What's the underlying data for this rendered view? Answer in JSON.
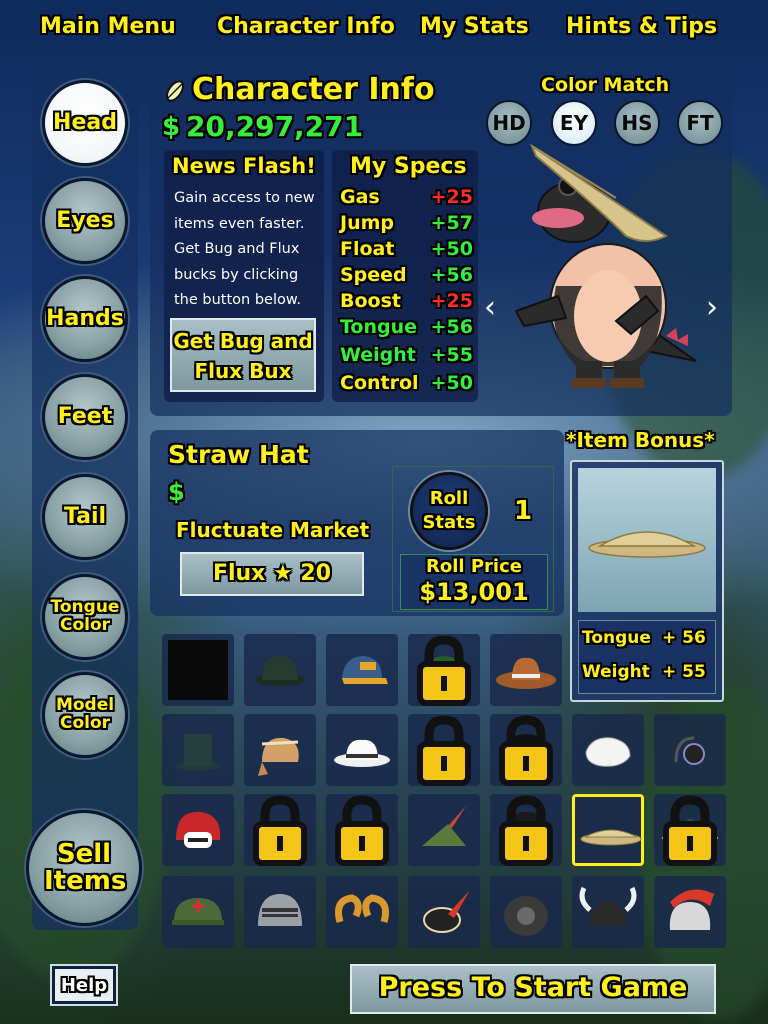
{
  "nav": {
    "main_menu": "Main Menu",
    "character_info": "Character Info",
    "my_stats": "My Stats",
    "hints_tips": "Hints & Tips"
  },
  "side": {
    "head": "Head",
    "eyes": "Eyes",
    "hands": "Hands",
    "feet": "Feet",
    "tail": "Tail",
    "tongue_color": "Tongue Color",
    "model_color": "Model Color",
    "sell_items": "Sell Items",
    "help": "Help"
  },
  "header": {
    "title": "Character Info",
    "money_symbol": "$",
    "money": "20,297,271"
  },
  "color_match": {
    "label": "Color Match",
    "buttons": [
      "HD",
      "EY",
      "HS",
      "FT"
    ],
    "selected": "EY"
  },
  "news": {
    "title": "News Flash!",
    "body": "Gain access to new items even faster. Get Bug and Flux bucks by clicking the button below.",
    "button": "Get Bug and Flux Bux"
  },
  "specs": {
    "title": "My Specs",
    "rows": [
      {
        "name": "Gas",
        "value": "+25",
        "color": "red"
      },
      {
        "name": "Jump",
        "value": "+57",
        "color": "green"
      },
      {
        "name": "Float",
        "value": "+50",
        "color": "green"
      },
      {
        "name": "Speed",
        "value": "+56",
        "color": "green"
      },
      {
        "name": "Boost",
        "value": "+25",
        "color": "red"
      },
      {
        "name": "Tongue",
        "value": "+56",
        "color": "green"
      },
      {
        "name": "Weight",
        "value": "+55",
        "color": "green"
      },
      {
        "name": "Control",
        "value": "+50",
        "color": "green"
      }
    ]
  },
  "item": {
    "name": "Straw Hat",
    "currency_symbol": "$",
    "market_label": "Fluctuate Market",
    "flux_label": "Flux ★ 20",
    "roll_button": "Roll Stats",
    "roll_count": "1",
    "roll_price_label": "Roll Price",
    "roll_price": "$13,001"
  },
  "bonus": {
    "title": "*Item Bonus*",
    "rows": [
      {
        "name": "Tongue",
        "value": "+ 56"
      },
      {
        "name": "Weight",
        "value": "+ 55"
      }
    ]
  },
  "grid": {
    "tiles": [
      {
        "name": "empty-slot",
        "locked": false
      },
      {
        "name": "bowler-hat",
        "locked": false
      },
      {
        "name": "baseball-cap",
        "locked": false
      },
      {
        "name": "beanie-hat",
        "locked": true
      },
      {
        "name": "cowboy-hat",
        "locked": false
      },
      {
        "name": "top-hat",
        "locked": false
      },
      {
        "name": "aviator-cap",
        "locked": false
      },
      {
        "name": "fedora-hat",
        "locked": false
      },
      {
        "name": "headband",
        "locked": true
      },
      {
        "name": "afro-hair",
        "locked": true
      },
      {
        "name": "glove-hat",
        "locked": false
      },
      {
        "name": "headphones",
        "locked": false
      },
      {
        "name": "football-helmet",
        "locked": false
      },
      {
        "name": "laurel-wreath",
        "locked": true
      },
      {
        "name": "pirate-hat",
        "locked": true
      },
      {
        "name": "robin-hood-hat",
        "locked": false
      },
      {
        "name": "space-helmet",
        "locked": true
      },
      {
        "name": "straw-hat",
        "locked": false,
        "selected": true
      },
      {
        "name": "tricorn-hat",
        "locked": true
      },
      {
        "name": "army-helmet",
        "locked": false
      },
      {
        "name": "knight-helmet",
        "locked": false
      },
      {
        "name": "ram-horns",
        "locked": false
      },
      {
        "name": "feather-cap",
        "locked": false
      },
      {
        "name": "diving-helmet",
        "locked": false
      },
      {
        "name": "viking-helmet",
        "locked": false
      },
      {
        "name": "spartan-helmet",
        "locked": false
      }
    ]
  },
  "start_button": "Press To Start Game"
}
